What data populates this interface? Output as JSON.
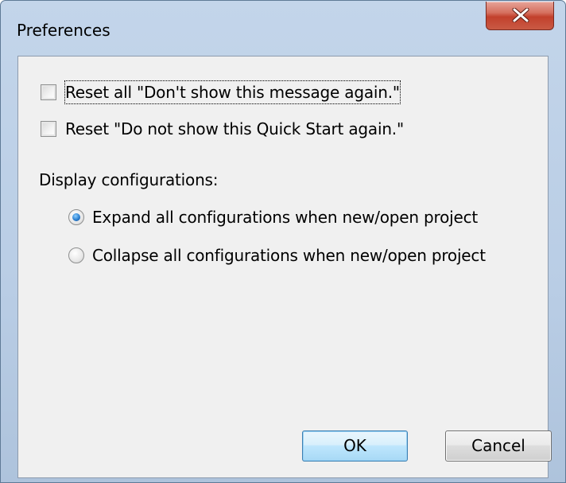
{
  "window": {
    "title": "Preferences"
  },
  "options": {
    "reset_messages_label": "Reset all \"Don't show this message again.\"",
    "reset_messages_checked": false,
    "reset_quickstart_label": "Reset \"Do not show this Quick Start again.\"",
    "reset_quickstart_checked": false
  },
  "display": {
    "group_label": "Display configurations:",
    "expand_label": "Expand all configurations when new/open project",
    "collapse_label": "Collapse all configurations when new/open project",
    "selected": "expand"
  },
  "buttons": {
    "ok_label": "OK",
    "cancel_label": "Cancel"
  },
  "colors": {
    "client_background": "#f0f0f0",
    "frame_blue": "#b9cde5",
    "close_red": "#c2402c",
    "default_button_border": "#3c7fb1"
  }
}
